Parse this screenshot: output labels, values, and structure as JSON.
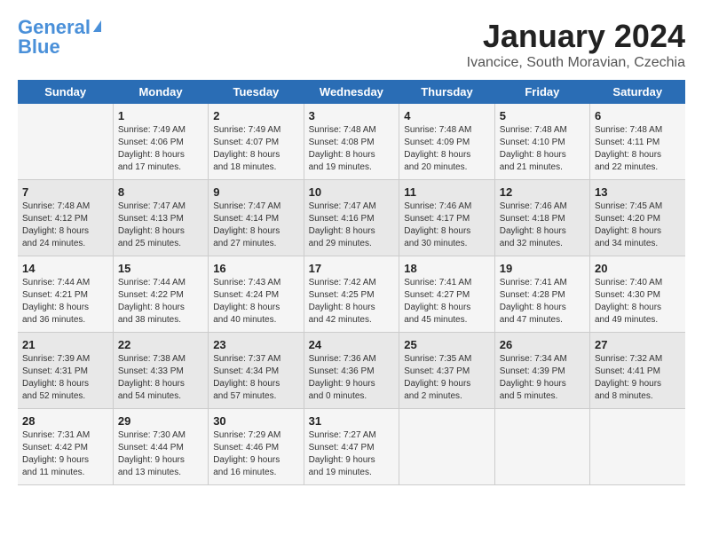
{
  "header": {
    "logo_line1": "General",
    "logo_line2": "Blue",
    "title": "January 2024",
    "subtitle": "Ivancice, South Moravian, Czechia"
  },
  "weekdays": [
    "Sunday",
    "Monday",
    "Tuesday",
    "Wednesday",
    "Thursday",
    "Friday",
    "Saturday"
  ],
  "weeks": [
    [
      {
        "day": "",
        "info": ""
      },
      {
        "day": "1",
        "info": "Sunrise: 7:49 AM\nSunset: 4:06 PM\nDaylight: 8 hours\nand 17 minutes."
      },
      {
        "day": "2",
        "info": "Sunrise: 7:49 AM\nSunset: 4:07 PM\nDaylight: 8 hours\nand 18 minutes."
      },
      {
        "day": "3",
        "info": "Sunrise: 7:48 AM\nSunset: 4:08 PM\nDaylight: 8 hours\nand 19 minutes."
      },
      {
        "day": "4",
        "info": "Sunrise: 7:48 AM\nSunset: 4:09 PM\nDaylight: 8 hours\nand 20 minutes."
      },
      {
        "day": "5",
        "info": "Sunrise: 7:48 AM\nSunset: 4:10 PM\nDaylight: 8 hours\nand 21 minutes."
      },
      {
        "day": "6",
        "info": "Sunrise: 7:48 AM\nSunset: 4:11 PM\nDaylight: 8 hours\nand 22 minutes."
      }
    ],
    [
      {
        "day": "7",
        "info": "Sunrise: 7:48 AM\nSunset: 4:12 PM\nDaylight: 8 hours\nand 24 minutes."
      },
      {
        "day": "8",
        "info": "Sunrise: 7:47 AM\nSunset: 4:13 PM\nDaylight: 8 hours\nand 25 minutes."
      },
      {
        "day": "9",
        "info": "Sunrise: 7:47 AM\nSunset: 4:14 PM\nDaylight: 8 hours\nand 27 minutes."
      },
      {
        "day": "10",
        "info": "Sunrise: 7:47 AM\nSunset: 4:16 PM\nDaylight: 8 hours\nand 29 minutes."
      },
      {
        "day": "11",
        "info": "Sunrise: 7:46 AM\nSunset: 4:17 PM\nDaylight: 8 hours\nand 30 minutes."
      },
      {
        "day": "12",
        "info": "Sunrise: 7:46 AM\nSunset: 4:18 PM\nDaylight: 8 hours\nand 32 minutes."
      },
      {
        "day": "13",
        "info": "Sunrise: 7:45 AM\nSunset: 4:20 PM\nDaylight: 8 hours\nand 34 minutes."
      }
    ],
    [
      {
        "day": "14",
        "info": "Sunrise: 7:44 AM\nSunset: 4:21 PM\nDaylight: 8 hours\nand 36 minutes."
      },
      {
        "day": "15",
        "info": "Sunrise: 7:44 AM\nSunset: 4:22 PM\nDaylight: 8 hours\nand 38 minutes."
      },
      {
        "day": "16",
        "info": "Sunrise: 7:43 AM\nSunset: 4:24 PM\nDaylight: 8 hours\nand 40 minutes."
      },
      {
        "day": "17",
        "info": "Sunrise: 7:42 AM\nSunset: 4:25 PM\nDaylight: 8 hours\nand 42 minutes."
      },
      {
        "day": "18",
        "info": "Sunrise: 7:41 AM\nSunset: 4:27 PM\nDaylight: 8 hours\nand 45 minutes."
      },
      {
        "day": "19",
        "info": "Sunrise: 7:41 AM\nSunset: 4:28 PM\nDaylight: 8 hours\nand 47 minutes."
      },
      {
        "day": "20",
        "info": "Sunrise: 7:40 AM\nSunset: 4:30 PM\nDaylight: 8 hours\nand 49 minutes."
      }
    ],
    [
      {
        "day": "21",
        "info": "Sunrise: 7:39 AM\nSunset: 4:31 PM\nDaylight: 8 hours\nand 52 minutes."
      },
      {
        "day": "22",
        "info": "Sunrise: 7:38 AM\nSunset: 4:33 PM\nDaylight: 8 hours\nand 54 minutes."
      },
      {
        "day": "23",
        "info": "Sunrise: 7:37 AM\nSunset: 4:34 PM\nDaylight: 8 hours\nand 57 minutes."
      },
      {
        "day": "24",
        "info": "Sunrise: 7:36 AM\nSunset: 4:36 PM\nDaylight: 9 hours\nand 0 minutes."
      },
      {
        "day": "25",
        "info": "Sunrise: 7:35 AM\nSunset: 4:37 PM\nDaylight: 9 hours\nand 2 minutes."
      },
      {
        "day": "26",
        "info": "Sunrise: 7:34 AM\nSunset: 4:39 PM\nDaylight: 9 hours\nand 5 minutes."
      },
      {
        "day": "27",
        "info": "Sunrise: 7:32 AM\nSunset: 4:41 PM\nDaylight: 9 hours\nand 8 minutes."
      }
    ],
    [
      {
        "day": "28",
        "info": "Sunrise: 7:31 AM\nSunset: 4:42 PM\nDaylight: 9 hours\nand 11 minutes."
      },
      {
        "day": "29",
        "info": "Sunrise: 7:30 AM\nSunset: 4:44 PM\nDaylight: 9 hours\nand 13 minutes."
      },
      {
        "day": "30",
        "info": "Sunrise: 7:29 AM\nSunset: 4:46 PM\nDaylight: 9 hours\nand 16 minutes."
      },
      {
        "day": "31",
        "info": "Sunrise: 7:27 AM\nSunset: 4:47 PM\nDaylight: 9 hours\nand 19 minutes."
      },
      {
        "day": "",
        "info": ""
      },
      {
        "day": "",
        "info": ""
      },
      {
        "day": "",
        "info": ""
      }
    ]
  ]
}
